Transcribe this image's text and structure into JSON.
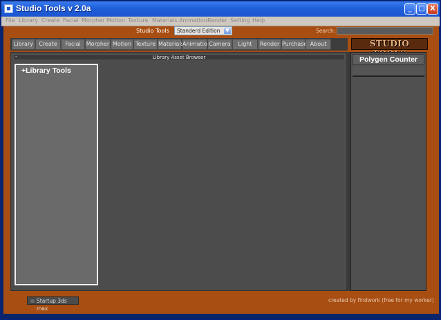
{
  "window": {
    "title": "Studio Tools v 2.0a",
    "controls": {
      "minimize": "_",
      "maximize": "□",
      "close": "X"
    }
  },
  "menubar": {
    "items": [
      "File",
      "Library",
      "Create",
      "Facial",
      "Morpher",
      "Motion",
      "Texture",
      "Materials",
      "Animation",
      "Render",
      "Setting",
      "Help"
    ]
  },
  "toolbar": {
    "label": "Studio Tools",
    "edition": "Standerd Edition",
    "search_label": "Search:",
    "search_value": ""
  },
  "tabs": [
    "Library",
    "Create",
    "Facial",
    "Morpher",
    "Motion",
    "Texture",
    "Materials",
    "Animation",
    "Camera",
    "Light",
    "Render",
    "Purchase",
    "About"
  ],
  "logo_text": "STUDIO TOOLS",
  "browser": {
    "collapse_symbol": "-",
    "title": "Library Asset Browser",
    "library_panel_title": "+Library Tools"
  },
  "side_panel": {
    "title": "Polygen Counter"
  },
  "footer": {
    "startup_label": "Startup 3ds max",
    "credit": "created by findwork (free for my worker)"
  },
  "colors": {
    "title_bar": "#1f5fd8",
    "frame": "#a84e12",
    "panel": "#4c4c4c",
    "menu_bar": "#cfc8be"
  },
  "icons": {
    "app": "studio-tools-app-icon",
    "dropdown": "chevron-down-icon"
  }
}
